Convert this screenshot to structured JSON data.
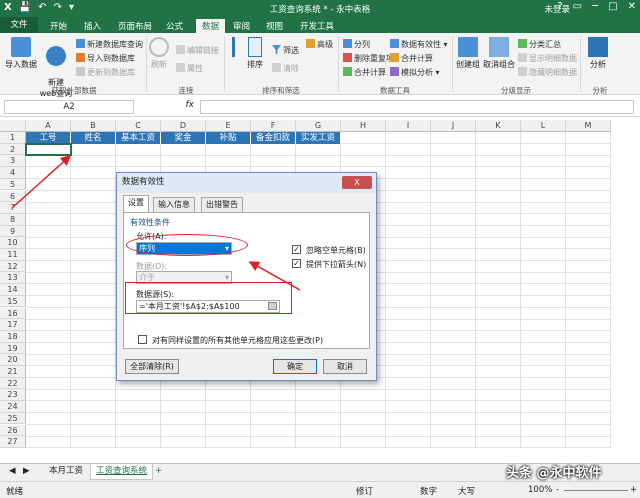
{
  "window": {
    "title": "工资查询系统 * - 永中表格",
    "user": "未登录",
    "qat": [
      "X",
      "💾",
      "↶",
      "↷",
      "▾"
    ],
    "ctl": [
      "?",
      "▭",
      "─",
      "□",
      "✕"
    ]
  },
  "tabs": [
    "文件",
    "开始",
    "插入",
    "页面布局",
    "公式",
    "数据",
    "审阅",
    "视图",
    "开发工具"
  ],
  "active_tab": "数据",
  "ribbon": {
    "import_data": "导入数据",
    "new_web_query": "新建\nweb查询",
    "new_db_query": "新建数据库查询",
    "import_to_db": "导入到数据库",
    "update_to_db": "更新到数据库",
    "group_external": "获取外部数据",
    "refresh": "刷新",
    "edit_links": "编辑链接",
    "link": "链接",
    "properties": "属性",
    "group_connect": "连接",
    "sort": "排序",
    "filter": "筛选",
    "advanced": "高级",
    "clear": "清除",
    "group_sort": "排序和筛选",
    "split": "分列",
    "remove_dup": "删除重复项",
    "consolidate": "合并计算",
    "validation": "数据有效性",
    "what_if": "模拟分析",
    "group_tools": "数据工具",
    "create_group": "创建组",
    "ungroup": "取消组合",
    "subtotal": "分类汇总",
    "show_detail": "显示明细数据",
    "hide_detail": "隐藏明细数据",
    "group_outline": "分级显示",
    "analysis": "分析",
    "group_analysis": "分析"
  },
  "formula": {
    "namebox": "A2",
    "fx": "fx",
    "value": ""
  },
  "columns": [
    "A",
    "B",
    "C",
    "D",
    "E",
    "F",
    "G",
    "H",
    "I",
    "J",
    "K",
    "L",
    "M"
  ],
  "rows": [
    "1",
    "2",
    "3",
    "4",
    "5",
    "6",
    "7",
    "8",
    "9",
    "10",
    "11",
    "12",
    "13",
    "14",
    "15",
    "16",
    "17",
    "18",
    "19",
    "20",
    "21",
    "22",
    "23",
    "24",
    "25",
    "26",
    "27"
  ],
  "headers": [
    "工号",
    "姓名",
    "基本工资",
    "奖金",
    "补贴",
    "备金扣款",
    "实发工资"
  ],
  "sheets": {
    "nav": [
      "◀",
      "▶"
    ],
    "tabs": [
      "本月工资",
      "工资查询系统"
    ],
    "add": "+"
  },
  "status": {
    "ready": "就绪",
    "modify": "修订",
    "number": "数字",
    "caps": "大写",
    "zoom": "100%",
    "zoom_minus": "-",
    "zoom_plus": "+"
  },
  "watermark": "头条 @永中软件",
  "dialog": {
    "title": "数据有效性",
    "close": "X",
    "tabs": [
      "设置",
      "输入信息",
      "出错警告"
    ],
    "criteria": "有效性条件",
    "allow_label": "允许(A):",
    "allow_value": "序列",
    "ignore_blank": "忽略空单元格(B)",
    "dropdown": "提供下拉箭头(N)",
    "data_label": "数据(D):",
    "data_value": "介于",
    "source_label": "数据源(S):",
    "source_value": "='本月工资'!$A$2:$A$100",
    "apply_all": "对有同样设置的所有其他单元格应用这些更改(P)",
    "clear_all": "全部清除(R)",
    "ok": "确定",
    "cancel": "取消"
  },
  "colors": {
    "green": "#217346",
    "header_blue": "#2e75b6",
    "annot_red": "#e31b23"
  }
}
